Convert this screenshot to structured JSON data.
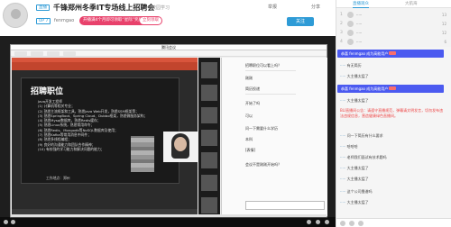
{
  "header": {
    "live_badge": "直播",
    "title": "千锋郑州冬季IT专场线上招聘会",
    "tag": "校园学习",
    "share_label": "举报",
    "share2_label": "分享",
    "up_badge": "UP 7",
    "streamer": "fenmgao",
    "promo_text": "开播满4个月即可领取“星际”奖励",
    "promo_button": "立刻领取",
    "follow_label": "关注"
  },
  "meeting": {
    "window_title": "腾讯会议",
    "slide_title": "招聘职位",
    "slide_lines": [
      "Java开发工程师",
      "(1) 计算机等相关专业；",
      "(2) 熟悉主流框架和工具，熟悉Java Web开发，熟悉SSM框架等；",
      "(3) 熟悉SpringBoot、Spring Cloud、Dubbo框架，熟悉微服务架构；",
      "(4) 熟悉Mysql数据库，熟悉Redis缓存；",
      "(5) 熟悉Linux系统，熟悉常用命令；",
      "(6) 熟悉Redis、Mongodb等NoSQL数据库及使用；",
      "(7) 熟悉Kafka等常用消息中间件；",
      "(8) 熟悉多线程编程；",
      "(9) 良好的沟通能力和团队合作精神；",
      "(10) 有较强的学习能力和解决问题的能力；"
    ],
    "slide_footer": "工作地点：郑州",
    "chat_messages": [
      "招聘职位可以看上吗？",
      "刚刚",
      "简历投递",
      "开始了吗",
      "可以",
      "问一下需要什么学历",
      "本科",
      "[表情]",
      "会议不是刚刚开始吗？"
    ]
  },
  "side": {
    "tabs": [
      "直播观众",
      "大航海"
    ],
    "ranks": [
      {
        "num": "1",
        "name": "·····",
        "val": "13"
      },
      {
        "num": "2",
        "name": "·····",
        "val": "12"
      },
      {
        "num": "3",
        "name": "·····",
        "val": "12"
      },
      {
        "num": "4",
        "name": "·····",
        "val": "6"
      }
    ],
    "notice1": "恭喜 fenmgao 成为高能用户",
    "notice2": "恭喜 fenmgao 成为高能用户",
    "messages": [
      {
        "who": "·····",
        "text": "有无简历"
      },
      {
        "who": "·····",
        "text": "大主播太猛了"
      },
      {
        "who": "·····",
        "text": "大主播太猛了"
      },
      {
        "who": "",
        "text": "BLI直播间公告：请遵守直播规范，弹幕请文明发言，切勿发布违法违规信息，营造健康绿色直播间。",
        "sys": true
      },
      {
        "who": "·····",
        "text": "问一下简历有什么要求"
      },
      {
        "who": "·····",
        "text": "哈哈哈"
      },
      {
        "who": "·····",
        "text": "老师我们面试有技术题吗"
      },
      {
        "who": "·····",
        "text": "大主播太猛了"
      },
      {
        "who": "·····",
        "text": "大主播太猛了"
      },
      {
        "who": "·····",
        "text": "这个公司靠谱吗"
      },
      {
        "who": "·····",
        "text": "大主播太猛了"
      }
    ]
  },
  "colors": {
    "accent": "#2e9bd6",
    "promo": "#e8416b",
    "notice": "#4b5af0",
    "video_bg": "#1e1e1e"
  }
}
